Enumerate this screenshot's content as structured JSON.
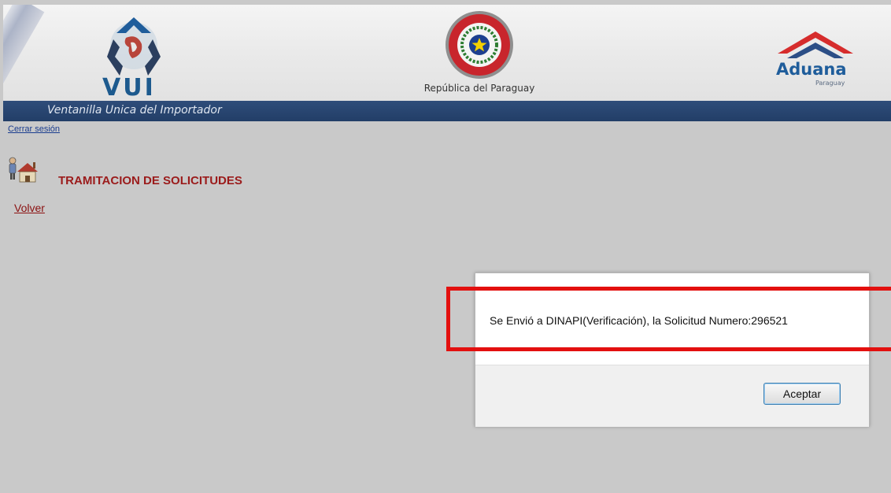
{
  "header": {
    "logo_text": "VUI",
    "republic_text": "República del Paraguay",
    "aduana_title": "Aduana",
    "aduana_subtitle": "Paraguay",
    "tagline": "Ventanilla Unica del Importador"
  },
  "session": {
    "logout_label": "Cerrar sesión"
  },
  "section": {
    "title": "TRAMITACION DE SOLICITUDES",
    "back_label": "Volver",
    "icon": "user-house-icon"
  },
  "dialog": {
    "message": "Se Envió a DINAPI(Verificación), la Solicitud Numero:296521",
    "accept_label": "Aceptar"
  },
  "colors": {
    "header_bar": "#223e67",
    "section_title": "#9b1b1b",
    "highlight": "#e3100f",
    "page_background": "#c9c9c9"
  }
}
